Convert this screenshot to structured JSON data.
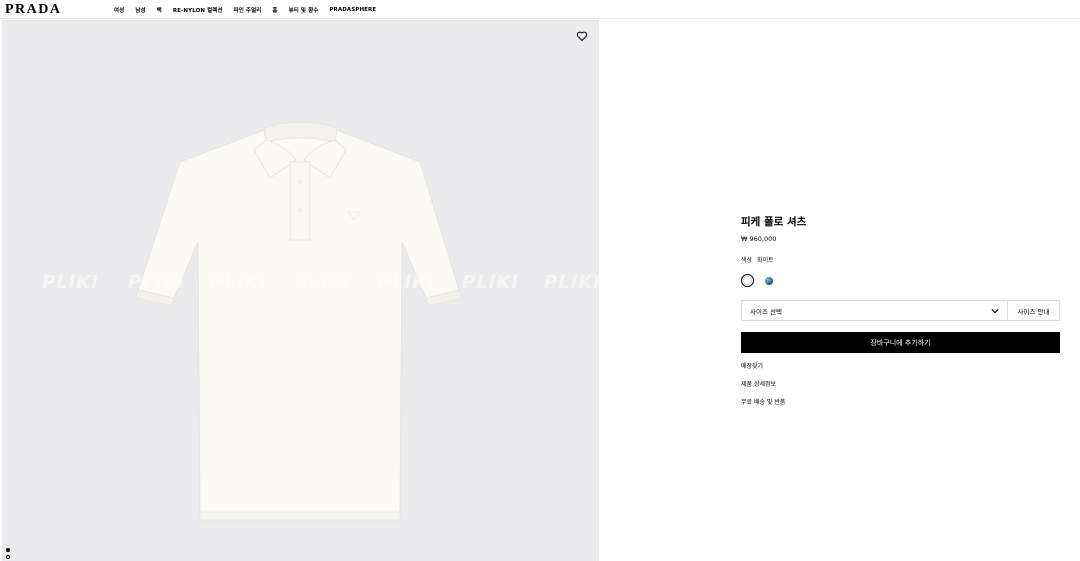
{
  "header": {
    "logo": "PRADA",
    "nav": [
      "여성",
      "남성",
      "백",
      "RE-NYLON 컬렉션",
      "파인 주얼리",
      "홈",
      "뷰티 및 향수",
      "PRADASPHERE"
    ]
  },
  "gallery": {
    "watermark": "PLIKI",
    "wishlist_icon": "heart-icon",
    "slide_indicator": {
      "total": 2,
      "active": 1
    }
  },
  "product": {
    "title": "피케 폴로 셔츠",
    "price": "₩ 960,000",
    "color_label": "색상",
    "color_value": "화이트",
    "swatches": [
      {
        "name": "white",
        "color": "#ffffff"
      },
      {
        "name": "blue",
        "color": "#2f5590"
      }
    ],
    "size_select": "사이즈 선택",
    "size_guide": "사이즈 안내",
    "add_to_cart": "장바구니에 추가하기",
    "links": [
      "매장찾기",
      "제품 상세정보",
      "무료 배송 및 반품"
    ]
  }
}
